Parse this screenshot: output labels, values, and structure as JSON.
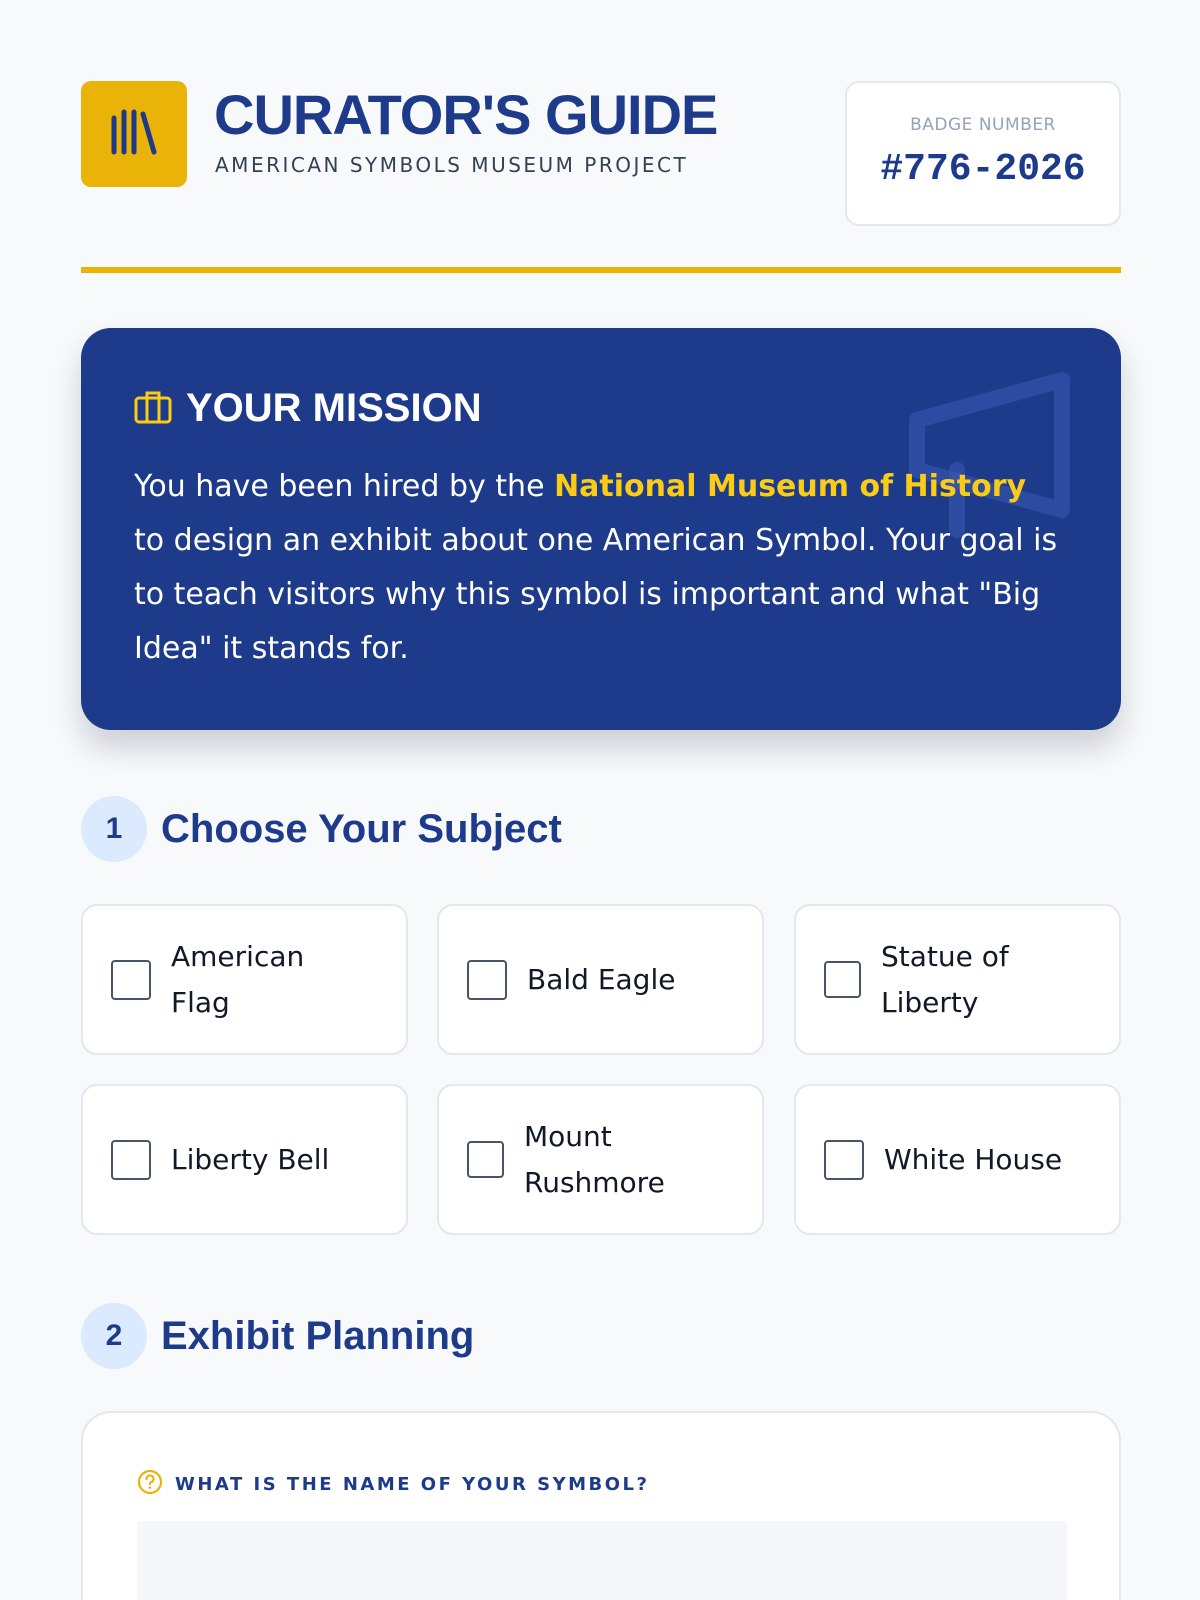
{
  "header": {
    "title": "CURATOR'S GUIDE",
    "subtitle": "AMERICAN SYMBOLS MUSEUM PROJECT",
    "badge_label": "BADGE NUMBER",
    "badge_number": "#776-2026",
    "logo_icon": "library-books-icon"
  },
  "colors": {
    "brand_navy": "#1e3a8a",
    "accent_gold": "#eab308",
    "highlight_yellow": "#facc15",
    "page_bg": "#f7f9fb"
  },
  "mission": {
    "title": "YOUR MISSION",
    "icon": "briefcase-icon",
    "decor_icon": "megaphone-icon",
    "text_before": "You have been hired by the ",
    "highlight": "National Museum of History",
    "text_after": " to design an exhibit about one American Symbol. Your goal is to teach visitors why this symbol is important and what \"Big Idea\" it stands for."
  },
  "sections": [
    {
      "number": "1",
      "title": "Choose Your Subject"
    },
    {
      "number": "2",
      "title": "Exhibit Planning"
    }
  ],
  "subjects": [
    {
      "label": "American Flag",
      "checked": false
    },
    {
      "label": "Bald Eagle",
      "checked": false
    },
    {
      "label": "Statue of Liberty",
      "checked": false
    },
    {
      "label": "Liberty Bell",
      "checked": false
    },
    {
      "label": "Mount Rushmore",
      "checked": false
    },
    {
      "label": "White House",
      "checked": false
    }
  ],
  "planning": {
    "question_icon": "question-circle-icon",
    "question_label": "WHAT IS THE NAME OF YOUR SYMBOL?",
    "answer_value": ""
  }
}
